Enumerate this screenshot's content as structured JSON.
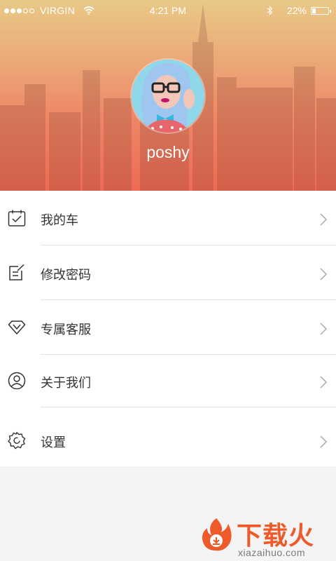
{
  "status_bar": {
    "carrier": "VIRGIN",
    "time": "4:21 PM",
    "battery_text": "22%",
    "battery_level": 0.22,
    "signal_dots_filled": 3,
    "signal_dots_total": 5
  },
  "profile": {
    "username": "poshy"
  },
  "menu": {
    "items": [
      {
        "label": "我的车",
        "icon": "calendar-check-icon"
      },
      {
        "label": "修改密码",
        "icon": "edit-note-icon"
      },
      {
        "label": "专属客服",
        "icon": "diamond-icon"
      },
      {
        "label": "关于我们",
        "icon": "user-circle-icon"
      },
      {
        "label": "设置",
        "icon": "gear-icon"
      }
    ]
  },
  "watermark": {
    "title": "下载火",
    "url": "xiazaihuo.com"
  },
  "colors": {
    "header_top": "#e9c987",
    "header_bottom": "#ee6a55",
    "text": "#333333",
    "watermark": "#ef5a2a"
  }
}
